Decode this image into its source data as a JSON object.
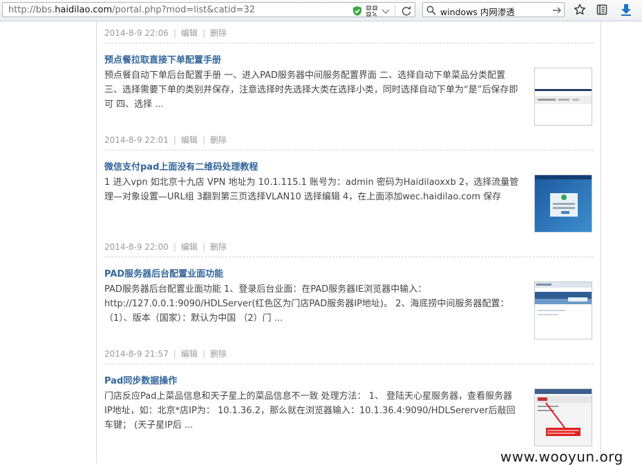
{
  "browser": {
    "url_prefix": "http://bbs.",
    "url_host": "haidilao.com",
    "url_path": "/portal.php?mod=list&catid=32",
    "search_value": "windows 内网渗透",
    "icons": {
      "shield": "shield-check-icon",
      "qr": "qr-code-icon",
      "dropdown": "chevron-down-icon",
      "reload": "reload-icon",
      "search": "search-icon",
      "go": "arrow-right-icon",
      "bookmark": "star-icon",
      "reading_list": "clipboard-icon",
      "download": "download-arrow-icon"
    },
    "colors": {
      "shield": "#3aa843",
      "download": "#1f73c7"
    }
  },
  "articles": [
    {
      "date": "2014-8-9 22:06",
      "edit": "编辑",
      "delete": "删除"
    },
    {
      "title": "预点餐拉取直接下单配置手册",
      "summary": "预点餐自动下单后台配置手册 一、进入PAD服务器中间服务配置界面 二、选择自动下单菜品分类配置 三、选择需要下单的类别并保存，注意选择时先选择大类在选择小类，同时选择自动下单为“是”后保存即可 四、选择 ...",
      "date": "2014-8-9 22:01",
      "edit": "编辑",
      "delete": "删除"
    },
    {
      "title": "微信支付pad上面没有二维码处理教程",
      "summary": "1 进入vpn 如北京十九店 VPN 地址为 10.1.115.1 账号为：admin 密码为Haidilaoxxb 2，选择流量管理—对象设置—URL组 3翻到第三页选择VLAN10 选择编辑 4，在上面添加wec.haidilao.com 保存",
      "date": "2014-8-9 22:00",
      "edit": "编辑",
      "delete": "删除"
    },
    {
      "title": "PAD服务器后台配置业面功能",
      "summary": "PAD服务器后台配置业面功能 1、登录后台业面：在PAD服务器IE浏览器中输入：http://127.0.0.1:9090/HDLServer(红色区为门店PAD服务器IP地址)。 2、海底捞中间服务器配置：（1）、版本（国家）：默认为中国 （2）门 ...",
      "date": "2014-8-9 21:57",
      "edit": "编辑",
      "delete": "删除"
    },
    {
      "title": "Pad同步数据操作",
      "summary": "门店反应Pad上菜品信息和天子星上的菜品信息不一致 处理方法： 1、 登陆天心星服务器，查看服务器IP地址，如：北京*店IP为： 10.1.36.2，那么就在浏览器输入：10.1.36.4:9090/HDLSererver后敲回车键； (天子星IP后 ..."
    }
  ],
  "watermark": "www.wooyun.org",
  "colors": {
    "title": "#336699",
    "text": "#444444",
    "meta": "#9a9a9a"
  }
}
